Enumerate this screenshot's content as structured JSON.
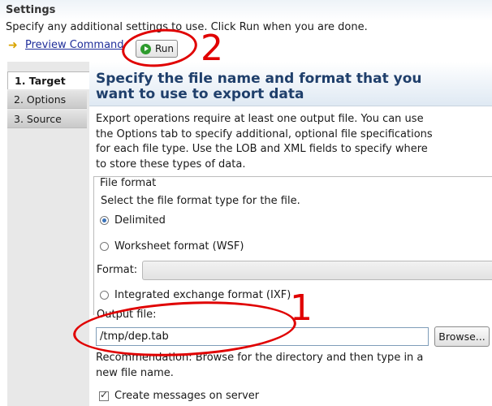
{
  "header": {
    "title": "Settings",
    "subtitle": "Specify any additional settings to use. Click Run when you are done."
  },
  "toolbar": {
    "preview_label": "Preview Command",
    "preview_icon": "preview-command-icon",
    "run_label": "Run",
    "run_icon": "run-play-icon"
  },
  "tabs": [
    {
      "label": "1. Target",
      "selected": true
    },
    {
      "label": "2. Options",
      "selected": false
    },
    {
      "label": "3. Source",
      "selected": false
    }
  ],
  "panel": {
    "title": "Specify the file name and format that you want to use to export data",
    "description": "Export operations require at least one output file. You can use the Options tab to specify additional, optional file specifications for each file type. Use the LOB and XML fields to specify where to store these types of data."
  },
  "file_format": {
    "legend": "File format",
    "help": "Select the file format type for the file.",
    "options": [
      {
        "label": "Delimited",
        "selected": true
      },
      {
        "label": "Worksheet format (WSF)",
        "selected": false
      },
      {
        "label": "Integrated exchange format (IXF)",
        "selected": false
      }
    ],
    "format_label": "Format:",
    "format_value": ""
  },
  "output": {
    "label": "Output file:",
    "value": "/tmp/dep.tab",
    "browse_label": "Browse...",
    "recommendation": "Recommendation: Browse for the directory and then type in a new file name."
  },
  "messages": {
    "label": "Create messages on server",
    "checked": true
  },
  "annotations": {
    "mark_1": "1",
    "mark_2": "2",
    "color": "#e00000"
  },
  "colors": {
    "panel_title": "#1f3f6b",
    "link": "#1f2e9a",
    "radio_selected": "#3b73b9",
    "run_icon": "#2e9b2e"
  }
}
